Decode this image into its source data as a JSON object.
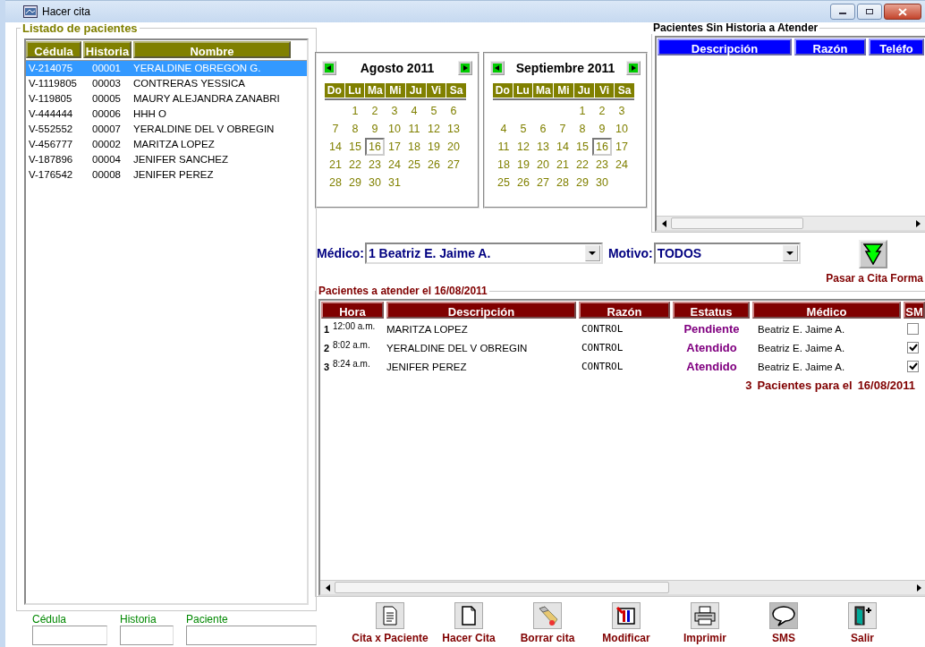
{
  "window": {
    "title": "Hacer cita"
  },
  "patients": {
    "title": "Listado de pacientes",
    "columns": [
      "Cédula",
      "Historia",
      "Nombre"
    ],
    "rows": [
      {
        "cedula": "V-214075",
        "historia": "00001",
        "nombre": "YERALDINE OBREGON  G.",
        "selected": true
      },
      {
        "cedula": "V-1119805",
        "historia": "00003",
        "nombre": "CONTRERAS YESSICA",
        "selected": false
      },
      {
        "cedula": "V-119805",
        "historia": "00005",
        "nombre": "MAURY ALEJANDRA ZANABRI",
        "selected": false
      },
      {
        "cedula": "V-444444",
        "historia": "00006",
        "nombre": "HHH O",
        "selected": false
      },
      {
        "cedula": "V-552552",
        "historia": "00007",
        "nombre": "YERALDINE DEL V OBREGIN",
        "selected": false
      },
      {
        "cedula": "V-456777",
        "historia": "00002",
        "nombre": "MARITZA  LOPEZ",
        "selected": false
      },
      {
        "cedula": "V-187896",
        "historia": "00004",
        "nombre": "JENIFER SANCHEZ",
        "selected": false
      },
      {
        "cedula": "V-176542",
        "historia": "00008",
        "nombre": "JENIFER PEREZ",
        "selected": false
      }
    ]
  },
  "calendars": [
    {
      "month": "Agosto 2011",
      "weekdays": [
        "Do",
        "Lu",
        "Ma",
        "Mi",
        "Ju",
        "Vi",
        "Sa"
      ],
      "weeks": [
        [
          {
            "day": "1",
            "selected": false
          },
          {
            "day": "2",
            "selected": false
          },
          {
            "day": "3",
            "selected": false
          },
          {
            "day": "4",
            "selected": false
          },
          {
            "day": "5",
            "selected": false
          },
          {
            "day": "6",
            "selected": false
          }
        ],
        [
          {
            "day": "7",
            "selected": false
          },
          {
            "day": "8",
            "selected": false
          },
          {
            "day": "9",
            "selected": false
          },
          {
            "day": "10",
            "selected": false
          },
          {
            "day": "11",
            "selected": false
          },
          {
            "day": "12",
            "selected": false
          },
          {
            "day": "13",
            "selected": false
          }
        ],
        [
          {
            "day": "14",
            "selected": false
          },
          {
            "day": "15",
            "selected": false
          },
          {
            "day": "16",
            "selected": true
          },
          {
            "day": "17",
            "selected": false
          },
          {
            "day": "18",
            "selected": false
          },
          {
            "day": "19",
            "selected": false
          },
          {
            "day": "20",
            "selected": false
          }
        ],
        [
          {
            "day": "21",
            "selected": false
          },
          {
            "day": "22",
            "selected": false
          },
          {
            "day": "23",
            "selected": false
          },
          {
            "day": "24",
            "selected": false
          },
          {
            "day": "25",
            "selected": false
          },
          {
            "day": "26",
            "selected": false
          },
          {
            "day": "27",
            "selected": false
          }
        ],
        [
          {
            "day": "28",
            "selected": false
          },
          {
            "day": "29",
            "selected": false
          },
          {
            "day": "30",
            "selected": false
          },
          {
            "day": "31",
            "selected": false
          }
        ]
      ]
    },
    {
      "month": "Septiembre 2011",
      "weekdays": [
        "Do",
        "Lu",
        "Ma",
        "Mi",
        "Ju",
        "Vi",
        "Sa"
      ],
      "weeks": [
        [
          {
            "day": "1",
            "selected": false
          },
          {
            "day": "2",
            "selected": false
          },
          {
            "day": "3",
            "selected": false
          }
        ],
        [
          {
            "day": "4",
            "selected": false
          },
          {
            "day": "5",
            "selected": false
          },
          {
            "day": "6",
            "selected": false
          },
          {
            "day": "7",
            "selected": false
          },
          {
            "day": "8",
            "selected": false
          },
          {
            "day": "9",
            "selected": false
          },
          {
            "day": "10",
            "selected": false
          }
        ],
        [
          {
            "day": "11",
            "selected": false
          },
          {
            "day": "12",
            "selected": false
          },
          {
            "day": "13",
            "selected": false
          },
          {
            "day": "14",
            "selected": false
          },
          {
            "day": "15",
            "selected": false
          },
          {
            "day": "16",
            "selected": true
          },
          {
            "day": "17",
            "selected": false
          }
        ],
        [
          {
            "day": "18",
            "selected": false
          },
          {
            "day": "19",
            "selected": false
          },
          {
            "day": "20",
            "selected": false
          },
          {
            "day": "21",
            "selected": false
          },
          {
            "day": "22",
            "selected": false
          },
          {
            "day": "23",
            "selected": false
          },
          {
            "day": "24",
            "selected": false
          }
        ],
        [
          {
            "day": "25",
            "selected": false
          },
          {
            "day": "26",
            "selected": false
          },
          {
            "day": "27",
            "selected": false
          },
          {
            "day": "28",
            "selected": false
          },
          {
            "day": "29",
            "selected": false
          },
          {
            "day": "30",
            "selected": false
          }
        ]
      ]
    }
  ],
  "no_history": {
    "title": "Pacientes Sin Historia a Atender",
    "columns": [
      "Descripción",
      "Razón",
      "Teléfo"
    ]
  },
  "filters": {
    "medico": {
      "label": "Médico:",
      "value": "1 Beatriz E. Jaime A."
    },
    "motivo": {
      "label": "Motivo:",
      "value": "TODOS"
    },
    "transfer_label": "Pasar a Cita Forma"
  },
  "appointments": {
    "title": "Pacientes a atender el 16/08/2011",
    "columns": [
      "Hora",
      "Descripción",
      "Razón",
      "Estatus",
      "Médico",
      "SM"
    ],
    "rows": [
      {
        "number": "1",
        "hora": "12:00 a.m.",
        "descripcion": "MARITZA  LOPEZ",
        "razon": "CONTROL",
        "estatus": "Pendiente",
        "medico": "Beatriz E. Jaime A.",
        "sms": false
      },
      {
        "number": "2",
        "hora": "8:02 a.m.",
        "descripcion": "YERALDINE DEL V OBREGIN",
        "razon": "CONTROL",
        "estatus": "Atendido",
        "medico": "Beatriz E. Jaime A.",
        "sms": true
      },
      {
        "number": "3",
        "hora": "8:24 a.m.",
        "descripcion": "JENIFER PEREZ",
        "razon": "CONTROL",
        "estatus": "Atendido",
        "medico": "Beatriz E. Jaime A.",
        "sms": true
      }
    ],
    "summary": {
      "count": "3",
      "text": "Pacientes para el",
      "date": "16/08/2011"
    }
  },
  "search": [
    {
      "label": "Cédula"
    },
    {
      "label": "Historia"
    },
    {
      "label": "Paciente"
    }
  ],
  "toolbar": [
    {
      "kind": "document",
      "label": "Cita x Paciente"
    },
    {
      "kind": "page",
      "label": "Hacer Cita"
    },
    {
      "kind": "eraser",
      "label": "Borrar cita"
    },
    {
      "kind": "edit",
      "label": "Modificar"
    },
    {
      "kind": "printer",
      "label": "Imprimir"
    },
    {
      "kind": "speech",
      "label": "SMS"
    },
    {
      "kind": "exit",
      "label": "Salir"
    }
  ]
}
